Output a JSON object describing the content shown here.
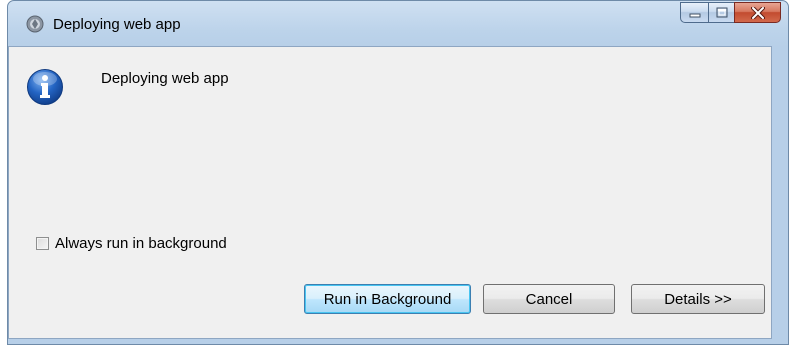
{
  "window": {
    "title": "Deploying web app",
    "title_icon": "app-globe-icon",
    "caption_buttons": [
      "minimize-icon",
      "maximize-icon",
      "close-icon"
    ]
  },
  "dialog": {
    "icon": "info-icon",
    "message": "Deploying web app",
    "checkbox": {
      "label": "Always run in background",
      "checked": false
    },
    "buttons": {
      "run_in_background": "Run in Background",
      "cancel": "Cancel",
      "details": "Details >>"
    }
  },
  "colors": {
    "titlebar": "#bcd3ea",
    "client": "#f0f0f0",
    "close_button": "#c24b2f",
    "default_button_border": "#3c7fb1",
    "info_icon": "#1f5fb8"
  }
}
